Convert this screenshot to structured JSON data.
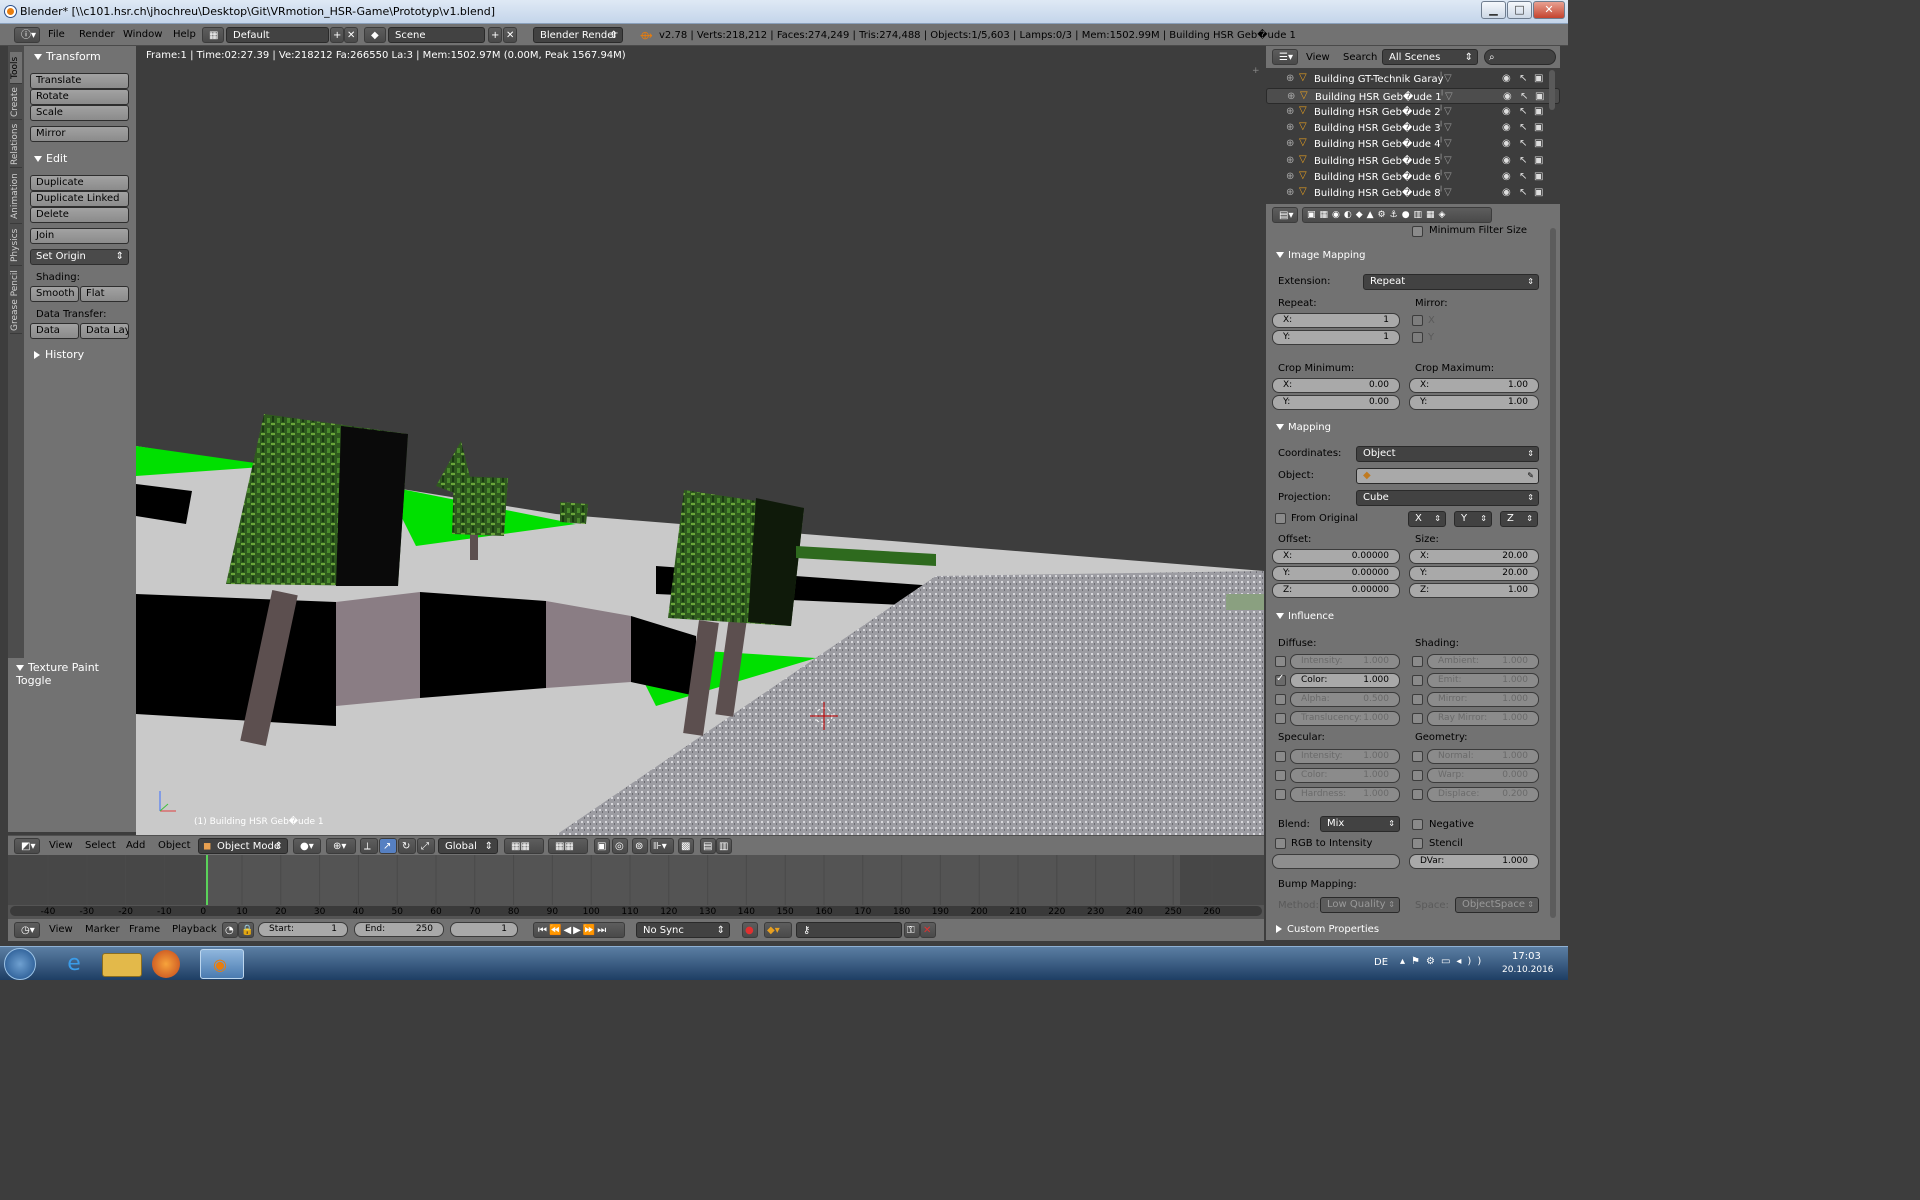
{
  "window": {
    "title": "Blender* [\\\\c101.hsr.ch\\jhochreu\\Desktop\\Git\\VRmotion_HSR-Game\\Prototyp\\v1.blend]",
    "min": "▁",
    "max": "□",
    "close": "✕"
  },
  "info_header": {
    "menus": [
      "File",
      "Render",
      "Window",
      "Help"
    ],
    "screen_layout": "Default",
    "scene": "Scene",
    "engine": "Blender Render",
    "stats": "v2.78 | Verts:218,212 | Faces:274,249 | Tris:274,488 | Objects:1/5,603 | Lamps:0/3 | Mem:1502.99M | Building HSR Geb�ude 1"
  },
  "toolshelf": {
    "tabs": [
      "Tools",
      "Create",
      "Relations",
      "Animation",
      "Physics",
      "Grease Pencil"
    ],
    "transform_title": "Transform",
    "translate": "Translate",
    "rotate": "Rotate",
    "scale": "Scale",
    "mirror": "Mirror",
    "edit_title": "Edit",
    "duplicate": "Duplicate",
    "duplicate_linked": "Duplicate Linked",
    "delete": "Delete",
    "join": "Join",
    "set_origin": "Set Origin",
    "shading_label": "Shading:",
    "smooth": "Smooth",
    "flat": "Flat",
    "data_transfer_label": "Data Transfer:",
    "data": "Data",
    "data_layo": "Data Layo",
    "history_title": "History",
    "texture_paint_toggle": "Texture Paint Toggle"
  },
  "viewport": {
    "info": "Frame:1 | Time:02:27.39 | Ve:218212 Fa:266550 La:3 | Mem:1502.97M (0.00M, Peak 1567.94M)",
    "object_label": "(1) Building HSR Geb�ude 1"
  },
  "viewport_header": {
    "menus": [
      "View",
      "Select",
      "Add",
      "Object"
    ],
    "mode": "Object Mode",
    "orientation": "Global"
  },
  "timeline": {
    "ticks": [
      "-40",
      "-30",
      "-20",
      "-10",
      "0",
      "10",
      "20",
      "30",
      "40",
      "50",
      "60",
      "70",
      "80",
      "90",
      "100",
      "110",
      "120",
      "130",
      "140",
      "150",
      "160",
      "170",
      "180",
      "190",
      "200",
      "210",
      "220",
      "230",
      "240",
      "250",
      "260"
    ],
    "menus": [
      "View",
      "Marker",
      "Frame",
      "Playback"
    ],
    "start_label": "Start:",
    "start_value": "1",
    "end_label": "End:",
    "end_value": "250",
    "current_frame": "1",
    "sync": "No Sync"
  },
  "outliner": {
    "view": "View",
    "search": "Search",
    "scenes": "All Scenes",
    "items": [
      {
        "name": "Building GT-Technik Garay",
        "selected": false
      },
      {
        "name": "Building HSR Geb�ude 1",
        "selected": true
      },
      {
        "name": "Building HSR Geb�ude 2",
        "selected": false
      },
      {
        "name": "Building HSR Geb�ude 3",
        "selected": false
      },
      {
        "name": "Building HSR Geb�ude 4",
        "selected": false
      },
      {
        "name": "Building HSR Geb�ude 5",
        "selected": false
      },
      {
        "name": "Building HSR Geb�ude 6",
        "selected": false
      },
      {
        "name": "Building HSR Geb�ude 8",
        "selected": false
      }
    ]
  },
  "properties": {
    "min_filter_size": "Minimum Filter Size",
    "image_mapping": {
      "title": "Image Mapping",
      "extension_label": "Extension:",
      "extension": "Repeat",
      "repeat_label": "Repeat:",
      "mirror_label": "Mirror:",
      "repeat_x_key": "X:",
      "repeat_x": "1",
      "repeat_y_key": "Y:",
      "repeat_y": "1",
      "mirror_x": "X",
      "mirror_y": "Y",
      "crop_min_label": "Crop Minimum:",
      "crop_max_label": "Crop Maximum:",
      "cmin_x": "0.00",
      "cmin_y": "0.00",
      "cmax_x": "1.00",
      "cmax_y": "1.00"
    },
    "mapping": {
      "title": "Mapping",
      "coordinates_label": "Coordinates:",
      "coordinates": "Object",
      "object_label": "Object:",
      "projection_label": "Projection:",
      "projection": "Cube",
      "from_original": "From Original",
      "axis_x": "X",
      "axis_y": "Y",
      "axis_z": "Z",
      "offset_label": "Offset:",
      "size_label": "Size:",
      "off_x": "0.00000",
      "off_y": "0.00000",
      "off_z": "0.00000",
      "size_x": "20.00",
      "size_y": "20.00",
      "size_z": "1.00",
      "x_key": "X:",
      "y_key": "Y:",
      "z_key": "Z:"
    },
    "influence": {
      "title": "Influence",
      "diffuse_label": "Diffuse:",
      "shading_label": "Shading:",
      "specular_label": "Specular:",
      "geometry_label": "Geometry:",
      "d_intensity": "Intensity:",
      "d_intensity_v": "1.000",
      "d_color": "Color:",
      "d_color_v": "1.000",
      "d_alpha": "Alpha:",
      "d_alpha_v": "0.500",
      "d_transl": "Translucency:",
      "d_transl_v": "1.000",
      "s_ambient": "Ambient:",
      "s_ambient_v": "1.000",
      "s_emit": "Emit:",
      "s_emit_v": "1.000",
      "s_mirror": "Mirror:",
      "s_mirror_v": "1.000",
      "s_raymirror": "Ray Mirror:",
      "s_raymirror_v": "1.000",
      "sp_intensity": "Intensity:",
      "sp_intensity_v": "1.000",
      "sp_color": "Color:",
      "sp_color_v": "1.000",
      "sp_hardness": "Hardness:",
      "sp_hardness_v": "1.000",
      "g_normal": "Normal:",
      "g_normal_v": "1.000",
      "g_warp": "Warp:",
      "g_warp_v": "0.000",
      "g_displace": "Displace:",
      "g_displace_v": "0.200",
      "blend_label": "Blend:",
      "blend": "Mix",
      "negative": "Negative",
      "rgb_to_intensity": "RGB to Intensity",
      "stencil": "Stencil",
      "dvar_key": "DVar:",
      "dvar": "1.000",
      "bump_mapping": "Bump Mapping:",
      "method_label": "Method:",
      "method": "Low Quality",
      "space_label": "Space:",
      "space": "ObjectSpace"
    },
    "custom_properties": "Custom Properties"
  },
  "taskbar": {
    "lang": "DE",
    "time": "17:03",
    "date": "20.10.2016"
  },
  "colors": {
    "panel": "#727272",
    "viewport_bg": "#3d3d3d",
    "grass": "#00e000",
    "accent": "#e87d0d"
  }
}
